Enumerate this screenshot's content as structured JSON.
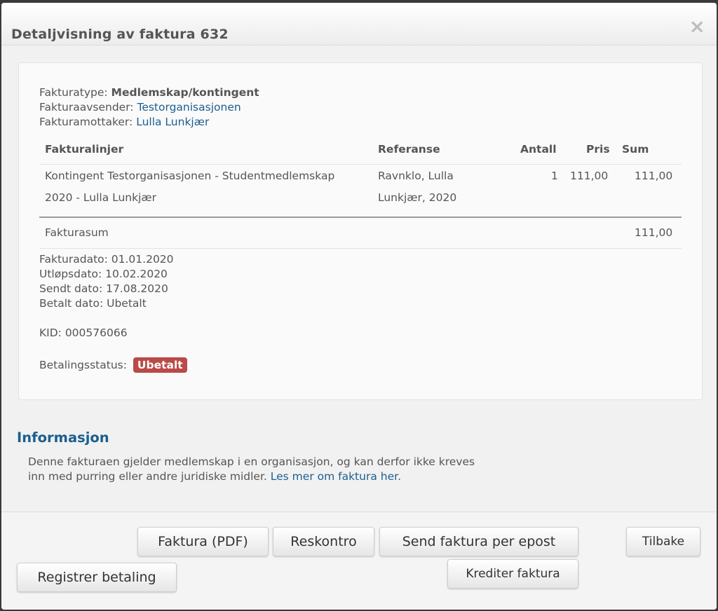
{
  "dialog": {
    "title": "Detaljvisning av faktura 632",
    "close_symbol": "×"
  },
  "invoice": {
    "type_label": "Fakturatype:",
    "type_value": "Medlemskap/kontingent",
    "sender_label": "Fakturaavsender:",
    "sender_value": "Testorganisasjonen",
    "recipient_label": "Fakturamottaker:",
    "recipient_value": "Lulla Lunkjær"
  },
  "table": {
    "headers": {
      "lines": "Fakturalinjer",
      "reference": "Referanse",
      "quantity": "Antall",
      "price": "Pris",
      "sum": "Sum"
    },
    "rows": [
      {
        "description_line1": "Kontingent Testorganisasjonen - Studentmedlemskap",
        "description_line2": "2020 - Lulla Lunkjær",
        "reference_line1": "Ravnklo, Lulla",
        "reference_line2": "Lunkjær, 2020",
        "quantity": "1",
        "price": "111,00",
        "sum": "111,00"
      }
    ],
    "total_label": "Fakturasum",
    "total_value": "111,00"
  },
  "dates": {
    "invoice_date": "Fakturadato: 01.01.2020",
    "due_date": "Utløpsdato: 10.02.2020",
    "sent_date": "Sendt dato: 17.08.2020",
    "paid_date": "Betalt dato: Ubetalt"
  },
  "kid": "KID: 000576066",
  "payment_status": {
    "label": "Betalingsstatus:",
    "value": "Ubetalt",
    "color": "#b94a48"
  },
  "information": {
    "heading": "Informasjon",
    "text_line1": "Denne fakturaen gjelder medlemskap i en organisasjon, og kan derfor ikke kreves",
    "text_line2": "inn med purring eller andre juridiske midler.",
    "link": "Les mer om faktura her",
    "link_suffix": "."
  },
  "buttons": {
    "pdf": "Faktura (PDF)",
    "ledger": "Reskontro",
    "send_email": "Send faktura per epost",
    "back": "Tilbake",
    "register_payment": "Registrer betaling",
    "credit": "Krediter faktura"
  },
  "colors": {
    "link": "#1b5f8f",
    "badge": "#b94a48"
  }
}
